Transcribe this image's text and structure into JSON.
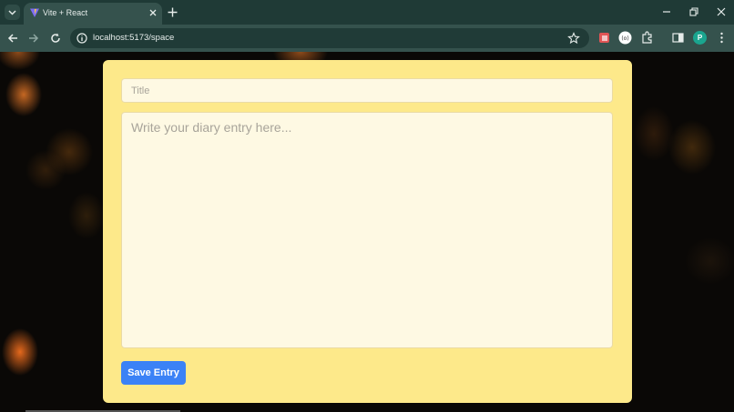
{
  "browser": {
    "tab_title": "Vite + React",
    "url": "localhost:5173/space",
    "profile_initial": "P"
  },
  "colors": {
    "card_background": "#fde98a",
    "field_background": "#fef9e3",
    "save_button": "#3b82f6",
    "chrome_frame": "#1f3a36",
    "chrome_toolbar": "#35524d"
  },
  "form": {
    "title_placeholder": "Title",
    "title_value": "",
    "entry_placeholder": "Write your diary entry here...",
    "entry_value": "",
    "save_label": "Save Entry"
  }
}
